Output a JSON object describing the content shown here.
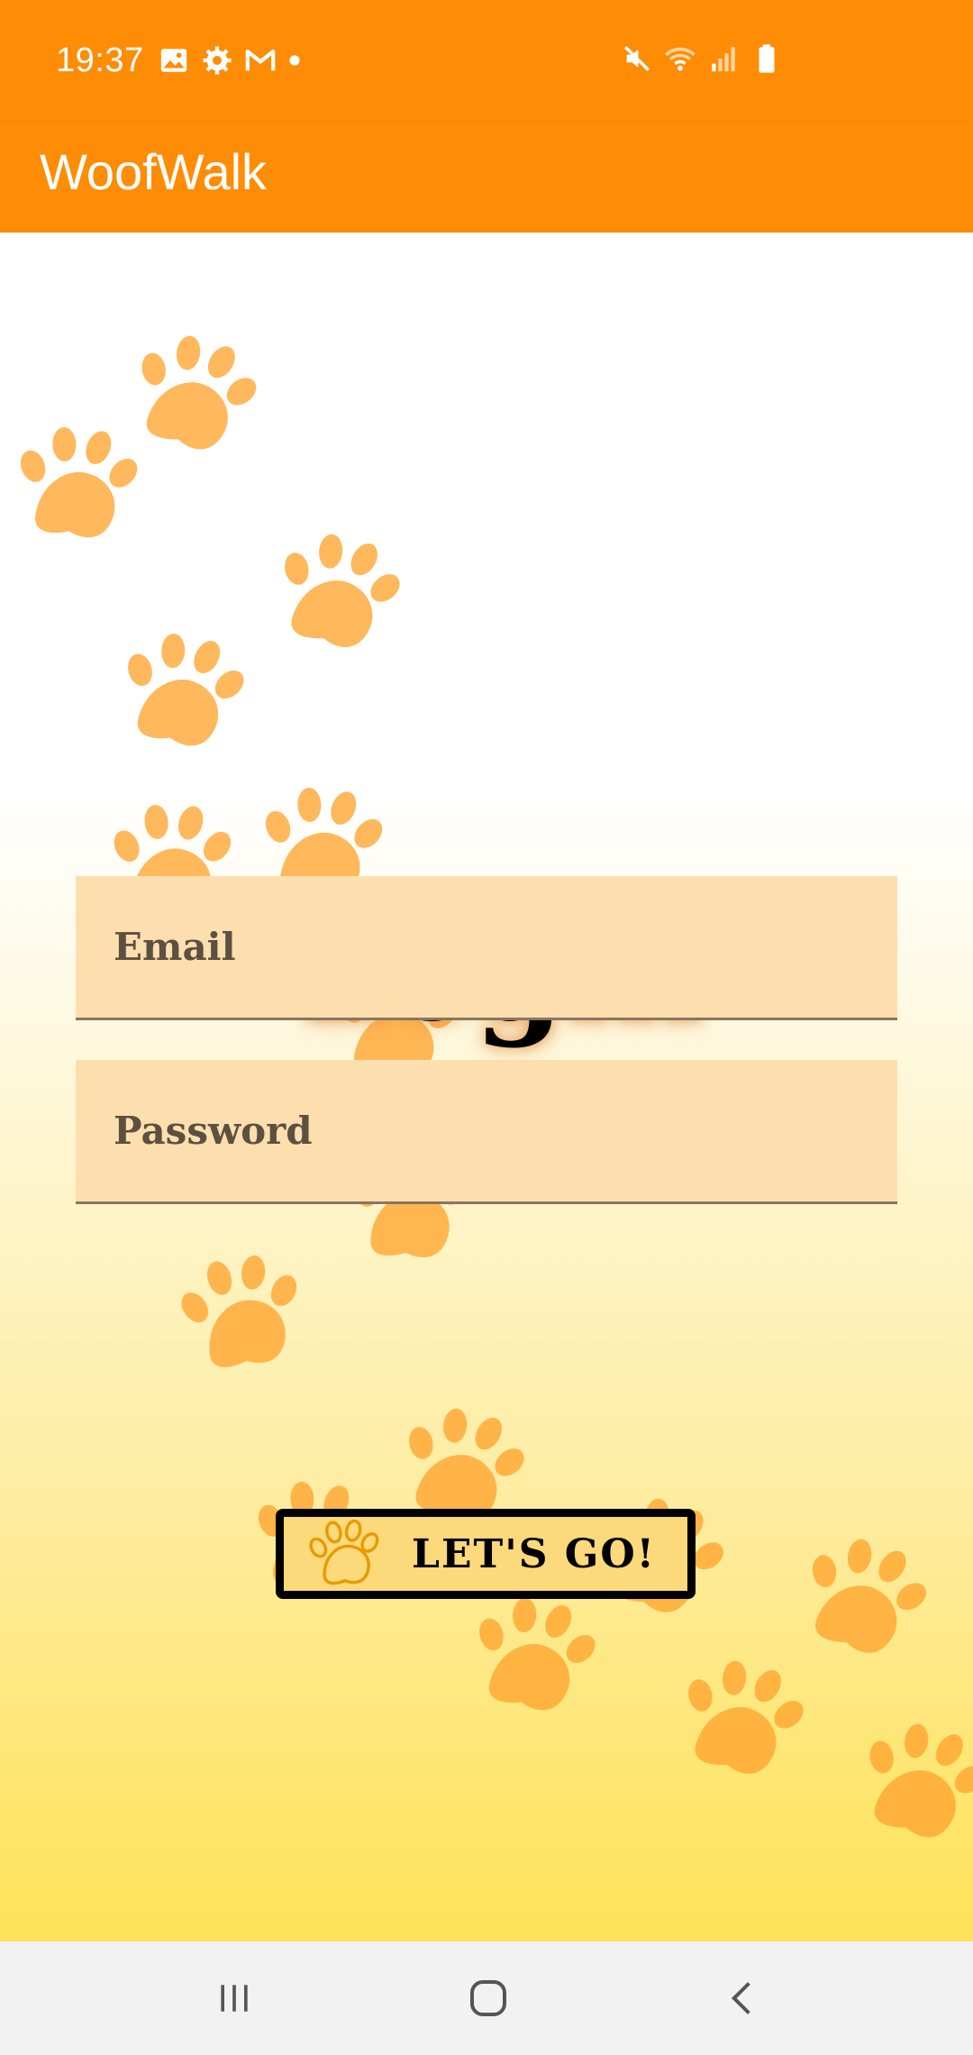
{
  "status_bar": {
    "time": "19:37",
    "left_icons": [
      "image-icon",
      "gear-icon",
      "gmail-icon",
      "dot-icon"
    ],
    "right_icons": [
      "mute-icon",
      "wifi-icon",
      "signal-icon",
      "battery-icon"
    ]
  },
  "app_bar": {
    "title": "WoofWalk"
  },
  "login": {
    "title": "Login",
    "email_placeholder": "Email",
    "password_placeholder": "Password",
    "submit_label": "LET'S GO!"
  },
  "nav_bar": {
    "buttons": [
      "recent-apps",
      "home",
      "back"
    ]
  },
  "colors": {
    "primary": "#FF8C05",
    "field_bg": "#FDDFAF",
    "button_bg": "#FCD97B",
    "paw": "#FFA42E"
  }
}
